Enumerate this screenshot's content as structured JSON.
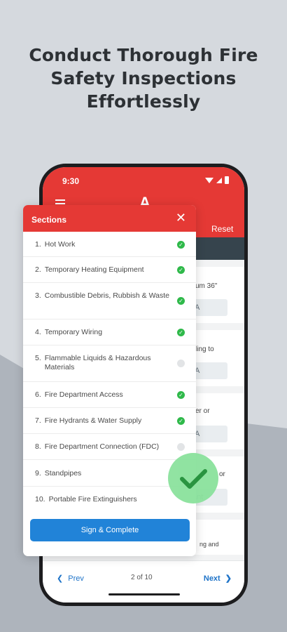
{
  "headline": {
    "line1": "Conduct Thorough Fire",
    "line2": "Safety Inspections",
    "line3": "Effortlessly"
  },
  "status_bar": {
    "time": "9:30",
    "icons": [
      "wifi-icon",
      "signal-icon",
      "battery-icon"
    ]
  },
  "app_header": {
    "logo": "A",
    "reset_label": "Reset"
  },
  "form_fields": [
    {
      "question": "um 36\"",
      "value": "/A"
    },
    {
      "question": "ling to",
      "value": "/A"
    },
    {
      "question": "er or",
      "value": "/A"
    },
    {
      "question": "or",
      "value": "ant"
    },
    {
      "question": "ng and",
      "value": ""
    }
  ],
  "modal": {
    "title": "Sections",
    "close_icon": "close-icon",
    "sections": [
      {
        "number": "1.",
        "label": "Hot Work",
        "done": true
      },
      {
        "number": "2.",
        "label": "Temporary Heating Equipment",
        "done": true
      },
      {
        "number": "3.",
        "label": "Combustible Debris, Rubbish & Waste",
        "done": true
      },
      {
        "number": "4.",
        "label": "Temporary Wiring",
        "done": true
      },
      {
        "number": "5.",
        "label": "Flammable Liquids & Hazardous Materials",
        "done": false
      },
      {
        "number": "6.",
        "label": "Fire Department Access",
        "done": true
      },
      {
        "number": "7.",
        "label": "Fire Hydrants & Water Supply",
        "done": true
      },
      {
        "number": "8.",
        "label": "Fire Department Connection (FDC)",
        "done": false
      },
      {
        "number": "9.",
        "label": "Standpipes",
        "done": false
      },
      {
        "number": "10.",
        "label": "Portable Fire Extinguishers",
        "done": false
      }
    ],
    "sign_label": "Sign & Complete"
  },
  "footer": {
    "prev_label": "Prev",
    "page_indicator": "2 of 10",
    "next_label": "Next"
  },
  "colors": {
    "brand_red": "#e53935",
    "primary_blue": "#2183d8",
    "success_green": "#2fb94a",
    "badge_green": "#8be29d",
    "dark_bar": "#36444d"
  }
}
